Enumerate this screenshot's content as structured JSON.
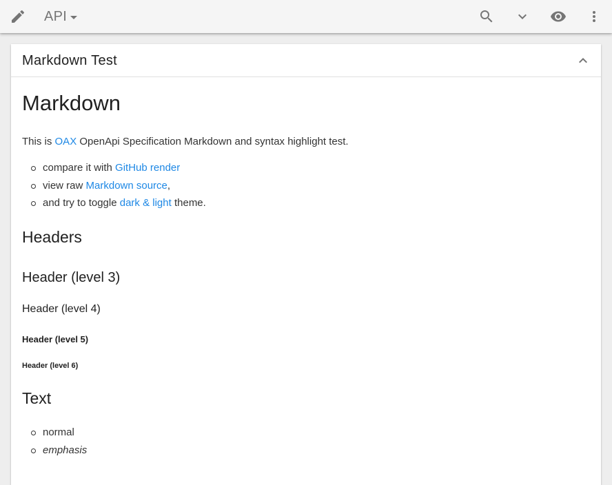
{
  "toolbar": {
    "edit_icon": "pencil-icon",
    "api_label": "API",
    "icons": [
      "search-icon",
      "chevron-down-icon",
      "eye-icon",
      "more-vert-icon"
    ]
  },
  "card": {
    "title": "Markdown Test",
    "collapse_icon": "chevron-up-icon"
  },
  "markdown": {
    "h1": "Markdown",
    "intro": {
      "prefix": "This is ",
      "link": "OAX",
      "suffix": " OpenApi Specification Markdown and syntax highlight test."
    },
    "bullets": [
      {
        "prefix": "compare it with ",
        "link": "GitHub render",
        "suffix": ""
      },
      {
        "prefix": "view raw ",
        "link": "Markdown source",
        "suffix": ","
      },
      {
        "prefix": "and try to toggle ",
        "link": "dark & light",
        "suffix": " theme."
      }
    ],
    "headers_title": "Headers",
    "h3": "Header (level 3)",
    "h4": "Header (level 4)",
    "h5": "Header (level 5)",
    "h6": "Header (level 6)",
    "text_title": "Text",
    "text_items": [
      "normal",
      "emphasis"
    ]
  },
  "colors": {
    "link": "#1e88e5",
    "toolbar_bg": "#f5f5f5",
    "icon": "#757575"
  }
}
